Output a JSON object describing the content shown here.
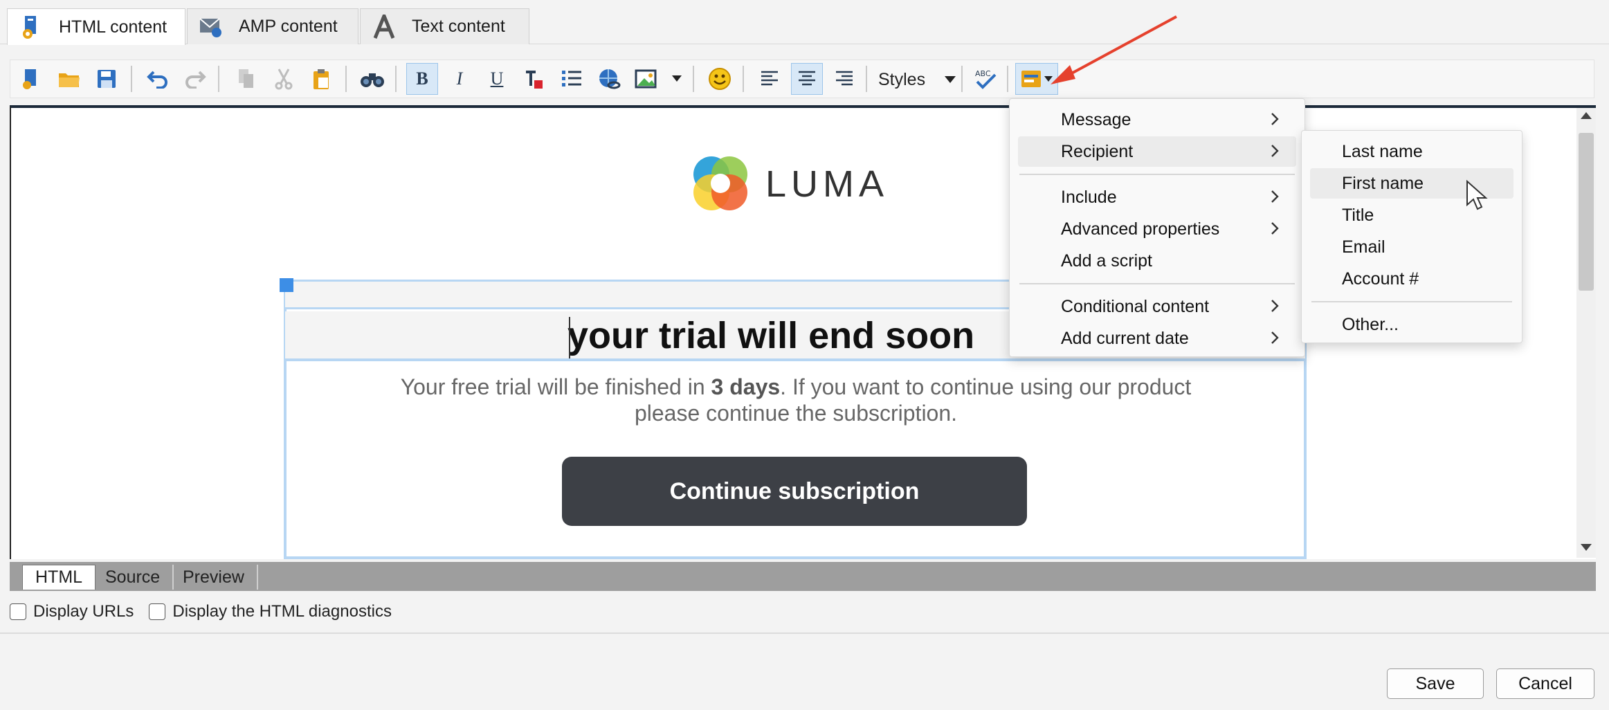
{
  "tabs": [
    {
      "label": "HTML content",
      "icon": "html-content-icon",
      "active": true
    },
    {
      "label": "AMP content",
      "icon": "amp-envelope-icon",
      "active": false
    },
    {
      "label": "Text content",
      "icon": "text-a-icon",
      "active": false
    }
  ],
  "toolbar": {
    "styles_label": "Styles",
    "colors": {
      "accent_blue": "#2e6fc0",
      "folder_orange": "#e8a317",
      "pressed_bg": "#d8e8f7"
    }
  },
  "email": {
    "logo_text": "LUMA",
    "headline": "your trial will end soon",
    "body_prefix": "Your free trial will be finished in ",
    "body_bold": "3 days",
    "body_suffix": ". If you want to continue using our product please continue the subscription.",
    "cta_label": "Continue subscription"
  },
  "menu": {
    "items": [
      {
        "label": "Message",
        "submenu": true
      },
      {
        "label": "Recipient",
        "submenu": true,
        "highlighted": true
      },
      {
        "label": "Include",
        "submenu": true
      },
      {
        "label": "Advanced properties",
        "submenu": true
      },
      {
        "label": "Add a script",
        "submenu": false
      },
      {
        "label": "Conditional content",
        "submenu": true
      },
      {
        "label": "Add current date",
        "submenu": true
      }
    ]
  },
  "submenu": {
    "items": [
      {
        "label": "Last name"
      },
      {
        "label": "First name",
        "highlighted": true
      },
      {
        "label": "Title"
      },
      {
        "label": "Email"
      },
      {
        "label": "Account #"
      },
      {
        "label": "Other..."
      }
    ]
  },
  "view_tabs": [
    "HTML",
    "Source",
    "Preview"
  ],
  "options": {
    "display_urls": "Display URLs",
    "display_diagnostics": "Display the HTML diagnostics"
  },
  "footer": {
    "save": "Save",
    "cancel": "Cancel"
  }
}
